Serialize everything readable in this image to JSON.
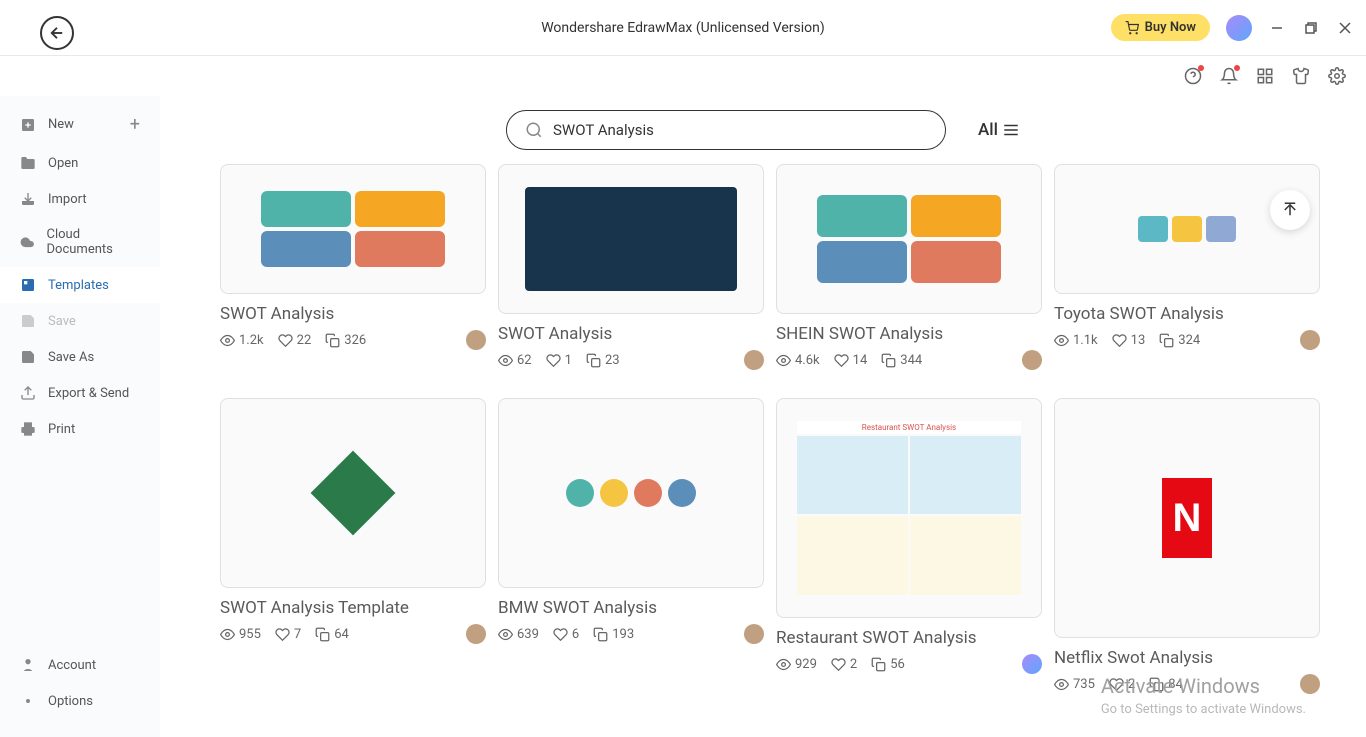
{
  "app": {
    "title": "Wondershare EdrawMax (Unlicensed Version)",
    "buy_now": "Buy Now"
  },
  "sidebar": {
    "new": "New",
    "open": "Open",
    "import": "Import",
    "cloud": "Cloud Documents",
    "templates": "Templates",
    "save": "Save",
    "save_as": "Save As",
    "export": "Export & Send",
    "print": "Print",
    "account": "Account",
    "options": "Options"
  },
  "search": {
    "value": "SWOT Analysis",
    "filter_label": "All"
  },
  "templates": [
    {
      "title": "SWOT Analysis",
      "views": "1.2k",
      "likes": "22",
      "copies": "326"
    },
    {
      "title": "SWOT Analysis",
      "views": "62",
      "likes": "1",
      "copies": "23"
    },
    {
      "title": "SHEIN SWOT Analysis",
      "views": "4.6k",
      "likes": "14",
      "copies": "344"
    },
    {
      "title": "Toyota SWOT Analysis",
      "views": "1.1k",
      "likes": "13",
      "copies": "324"
    },
    {
      "title": "SWOT Analysis Template",
      "views": "955",
      "likes": "7",
      "copies": "64"
    },
    {
      "title": "BMW SWOT Analysis",
      "views": "639",
      "likes": "6",
      "copies": "193"
    },
    {
      "title": "Restaurant SWOT Analysis",
      "views": "929",
      "likes": "2",
      "copies": "56"
    },
    {
      "title": "Netflix Swot Analysis",
      "views": "735",
      "likes": "2",
      "copies": "84"
    }
  ],
  "watermark": {
    "title": "Activate Windows",
    "subtitle": "Go to Settings to activate Windows."
  }
}
